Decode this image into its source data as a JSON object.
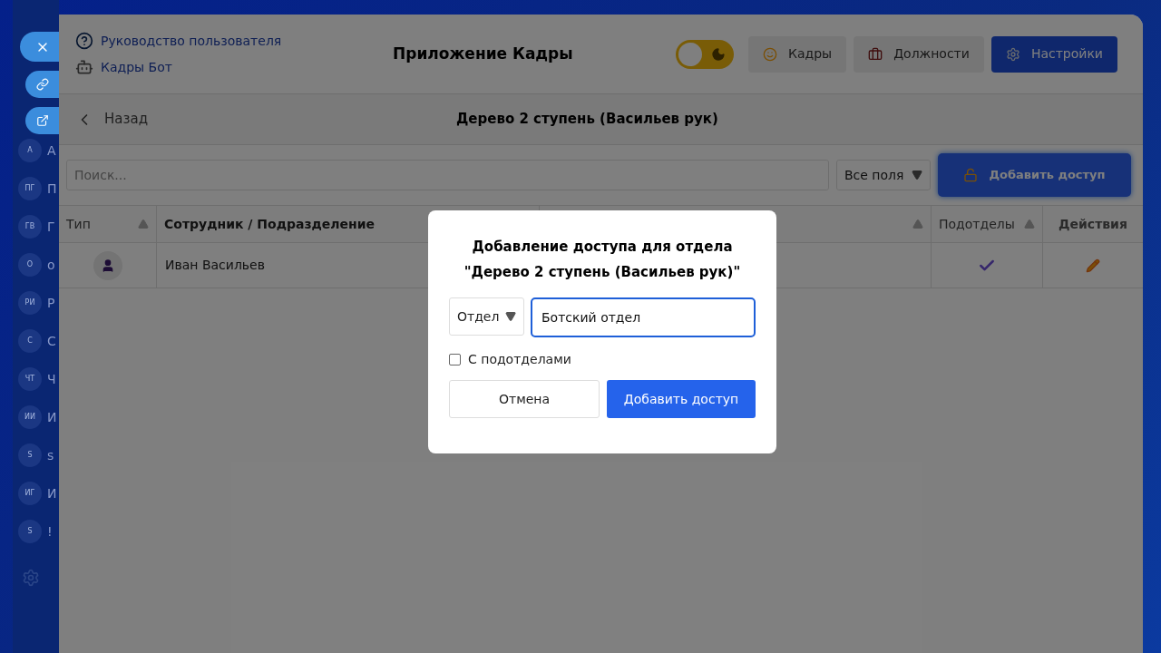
{
  "sidebar": {
    "items": [
      {
        "initials": "A",
        "label": "А"
      },
      {
        "initials": "ПГ",
        "label": "П"
      },
      {
        "initials": "ГВ",
        "label": "Г"
      },
      {
        "initials": "О",
        "label": "о"
      },
      {
        "initials": "РИ",
        "label": "Р"
      },
      {
        "initials": "С",
        "label": "С"
      },
      {
        "initials": "ЧТ",
        "label": "Ч"
      },
      {
        "initials": "ИИ",
        "label": "И"
      },
      {
        "initials": "S",
        "label": "s"
      },
      {
        "initials": "ИГ",
        "label": "И"
      },
      {
        "initials": "S",
        "label": "!"
      }
    ]
  },
  "header": {
    "links": [
      {
        "kind": "help",
        "label": "Руководство пользователя"
      },
      {
        "kind": "bot",
        "label": "Кадры Бот"
      }
    ],
    "title": "Приложение Кадры",
    "dark_mode": {
      "on": false
    },
    "nav": [
      {
        "kind": "people",
        "label": "Кадры",
        "selected": false
      },
      {
        "kind": "positions",
        "label": "Должности",
        "selected": false
      },
      {
        "kind": "settings",
        "label": "Настройки",
        "selected": true
      }
    ]
  },
  "subheader": {
    "back": "Назад",
    "title": "Дерево 2 ступень (Васильев рук)"
  },
  "toolbar": {
    "search": {
      "placeholder": "Поиск..."
    },
    "filter": "Все поля",
    "add_button": "Добавить доступ"
  },
  "table": {
    "columns": [
      {
        "label": "Тип",
        "sortable": true
      },
      {
        "label": "Сотрудник / Подразделение"
      },
      {
        "sortable": true
      },
      {
        "label": "Подотделы",
        "sortable": true
      },
      {
        "label": "Действия",
        "sortable": false
      }
    ],
    "rows": [
      {
        "kind": "employee",
        "name": "Иван Васильев",
        "subdivisions": true
      }
    ]
  },
  "modal": {
    "title": [
      "Добавление доступа для отдела",
      "\"Дерево 2 ступень (Васильев рук)\""
    ],
    "type_select": "Отдел",
    "name_input": {
      "value": "Ботский отдел"
    },
    "checkbox": {
      "label": "С подотделами",
      "checked": false
    },
    "buttons": [
      {
        "kind": "cancel",
        "label": "Отмена"
      },
      {
        "kind": "confirm",
        "label": "Добавить доступ"
      }
    ]
  }
}
